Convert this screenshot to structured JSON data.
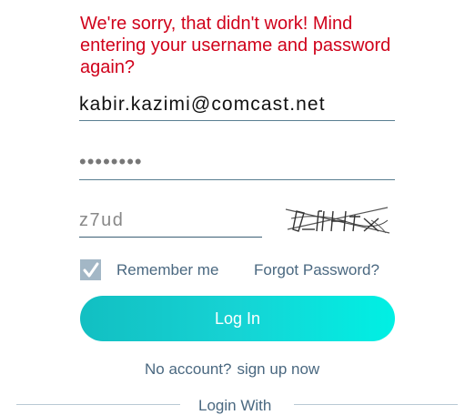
{
  "error_message": "We're sorry, that didn't work! Mind entering your username and password again?",
  "username": {
    "value": "kabir.kazimi@comcast.net"
  },
  "password": {
    "masked_value": "••••••••"
  },
  "captcha": {
    "input_value": "z7ud"
  },
  "remember": {
    "label": "Remember me",
    "checked": true
  },
  "forgot_password": {
    "label": "Forgot Password?"
  },
  "login_button": {
    "label": "Log In"
  },
  "signup": {
    "prompt": "No account?",
    "link_label": "sign up now"
  },
  "login_with": {
    "label": "Login With"
  },
  "colors": {
    "error": "#d0021b",
    "text_muted": "#4a6880",
    "button_gradient_start": "#12bfc2",
    "button_gradient_end": "#00f0e4",
    "checkbox_bg": "#a3b7c6"
  }
}
